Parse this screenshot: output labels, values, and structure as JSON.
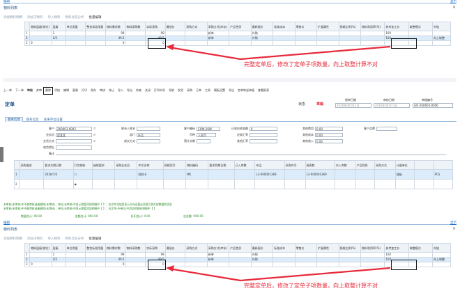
{
  "top": {
    "title": "物料列表",
    "link_right": "显示",
    "toolbar": [
      "添加物料明细",
      "添加子物料",
      "导入物料",
      "物料比较分析",
      "批量编辑",
      "重置物料"
    ],
    "headers": [
      "",
      "物料层级(按位)",
      "层级",
      "单位用量",
      "整包标准用量",
      "物料需求数",
      "物料采购数",
      "实际采购",
      "最低价",
      "采购方式",
      "采购方式(库存)",
      "产品性质",
      "最新报价",
      "标准成本",
      "零售价",
      "扩展属性",
      "损耗比例(%)",
      "物料利用率(%)",
      "参考加工价",
      "取整模式",
      "外链"
    ],
    "rows": [
      [
        "1",
        "",
        "1",
        "",
        "",
        "99",
        "",
        "99",
        "",
        "",
        "新单",
        "",
        "外购",
        "",
        "",
        "",
        "",
        "",
        "100",
        "",
        "",
        ""
      ],
      [
        "2",
        "",
        "1/2",
        "",
        "",
        "49.5",
        "",
        "49.5",
        "",
        "",
        "新单",
        "",
        "外购",
        "",
        "",
        "",
        "",
        "",
        "100",
        "",
        "向上取整",
        ""
      ],
      [
        "3",
        "0",
        "",
        "",
        "",
        "0",
        "",
        "0",
        "",
        "",
        "",
        "",
        "",
        "",
        "",
        "",
        "",
        "",
        "",
        "",
        "",
        ""
      ]
    ],
    "annotation": "完整定单后，修改了定单子项数量，向上取整计算不对"
  },
  "toolbar2": [
    "上一单",
    "下一单",
    "审核",
    "弃审",
    "删除",
    "添加",
    "编辑",
    "复制",
    "打印",
    "保存",
    "审核",
    "终止",
    "导入",
    "导出",
    "作废",
    "关闭",
    "打印向导",
    "导航",
    "发货",
    "采购",
    "订单",
    "工具",
    "模板设置",
    "导出",
    "定单转送单据",
    "查看报表"
  ],
  "form": {
    "title": "定单",
    "status_label": "状态",
    "status_value": "草稿",
    "date_headers": [
      "制单日期",
      "审核日期",
      "单据编号"
    ],
    "date_values": [
      "2026年06月11日",
      "2026年06月11日",
      "GO-260603-0006"
    ],
    "tabs": [
      "基本信息",
      "联系信息",
      "往来单位设置"
    ],
    "fields": {
      "customer": {
        "label": "客户",
        "value": "260603-0002"
      },
      "salesperson": {
        "label": "业务员",
        "value": "梁某某"
      },
      "ship_method": {
        "label": "交货方式",
        "value": ""
      },
      "receive_addr": {
        "label": "收货地址",
        "value": ""
      },
      "remark": {
        "label": "备注",
        "value": ""
      },
      "contact": {
        "label": "联系人姓名",
        "value": ""
      },
      "dept": {
        "label": "部门",
        "value": "外品"
      },
      "deliver_way": {
        "label": "成交方式",
        "value": ""
      },
      "currency_label": "客户编码",
      "currency": "COM-26W",
      "tax_label": "币种",
      "tax": "人民币",
      "delivery_label": "预计交期",
      "delivery": "",
      "paid_label": "已收应收金额",
      "paid": "0",
      "receivable_label": "应收汇率",
      "receivable": "",
      "extra_label": "其他汇率",
      "extra": "",
      "f1_label": "其他费用",
      "f1": "0.00",
      "f2_label": "其他成本",
      "f2": "0.00",
      "f3_label": "其他收入",
      "f3": "0.00",
      "code_label": "客户品牌"
    }
  },
  "grid": {
    "headers": [
      "",
      "采购描述",
      "要求交期日期",
      "打包物料",
      "抽取要求",
      "采购业务员",
      "中文名称",
      "规格型号",
      "物料编码",
      "要求到期日期",
      "已入库数",
      "布品",
      "采购件号",
      "报表数",
      "本入库数",
      "产品性质",
      "采购方式",
      "计量单位"
    ],
    "rows": [
      [
        "1",
        "",
        "2026/7/3",
        "☐",
        "",
        "",
        "网纹卡",
        "",
        "MK",
        "",
        "",
        "L3-000001369",
        "",
        "L3-000001369",
        "",
        "",
        "",
        "链接",
        "",
        "PCS"
      ],
      [
        "2",
        "",
        "",
        "◉",
        "",
        "",
        "",
        "",
        "",
        "",
        "",
        "",
        "",
        "",
        "",
        "",
        "",
        "",
        "",
        ""
      ]
    ]
  },
  "warnings": [
    "未审核(未审核)中不能审核或者删除(未审核)；单位(未审核)中显示需要添加明细中【 】；在文件添加里显示方向运营必须填写到外部数据的信息",
    "未审核(未审核)中不能审核或者删除(未审核)；单位(未审核)中显示需要添加明细中【 】；在文件(外单位)中添加的物料明细中【 】"
  ],
  "totals": {
    "qty_label": "数量合计",
    "qty": "99.00",
    "amt_label": "金额合计",
    "amt": "990.00",
    "discount_label": "折扣合计",
    "discount": "0.00",
    "total_label": "总金额",
    "total": "990.00"
  },
  "bottom": {
    "title": "物料列表",
    "annotation": "完整定单后，修改了定单子项数量，向上取整计算不对"
  },
  "colors": {
    "accent": "#e8293a",
    "highlight_box": "#111111",
    "link": "#1a6fc7",
    "header_bg": "#eef3f8",
    "select_bg": "#dcecfb",
    "warn": "#2a8a2a"
  }
}
